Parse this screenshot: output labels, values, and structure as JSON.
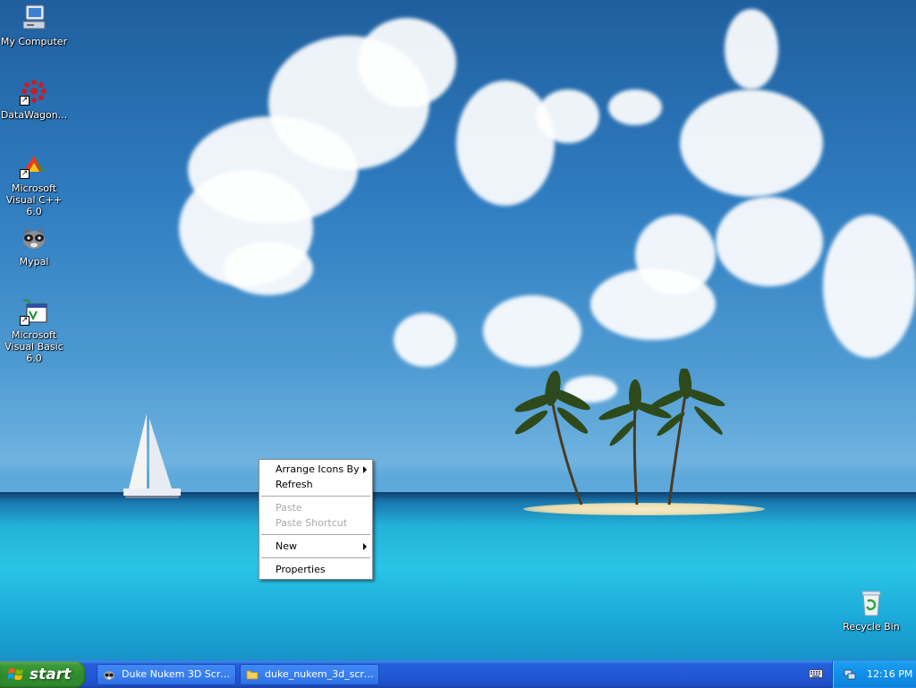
{
  "desktop": {
    "icons": [
      {
        "label": "My Computer",
        "icon": "my-computer-icon"
      },
      {
        "label": "DataWagon...",
        "icon": "datawagon-icon"
      },
      {
        "label": "Microsoft Visual C++ 6.0",
        "icon": "visual-cpp-icon"
      },
      {
        "label": "Mypal",
        "icon": "mypal-icon"
      },
      {
        "label": "Microsoft Visual Basic 6.0",
        "icon": "visual-basic-icon"
      },
      {
        "label": "Recycle Bin",
        "icon": "recycle-bin-icon"
      }
    ]
  },
  "context_menu": {
    "arrange_icons_by": "Arrange Icons By",
    "refresh": "Refresh",
    "paste": "Paste",
    "paste_shortcut": "Paste Shortcut",
    "new": "New",
    "properties": "Properties"
  },
  "taskbar": {
    "start_label": "start",
    "tasks": [
      {
        "label": "Duke Nukem 3D Scre...",
        "icon": "mypal-icon"
      },
      {
        "label": "duke_nukem_3d_scre...",
        "icon": "folder-icon"
      }
    ],
    "clock": "12:16 PM"
  },
  "colors": {
    "taskbar_blue": "#245edb",
    "start_green": "#3c9a3a",
    "tray_blue": "#1290e8",
    "sky_blue": "#2f7cc0",
    "sea_cyan": "#2ac4e6"
  }
}
